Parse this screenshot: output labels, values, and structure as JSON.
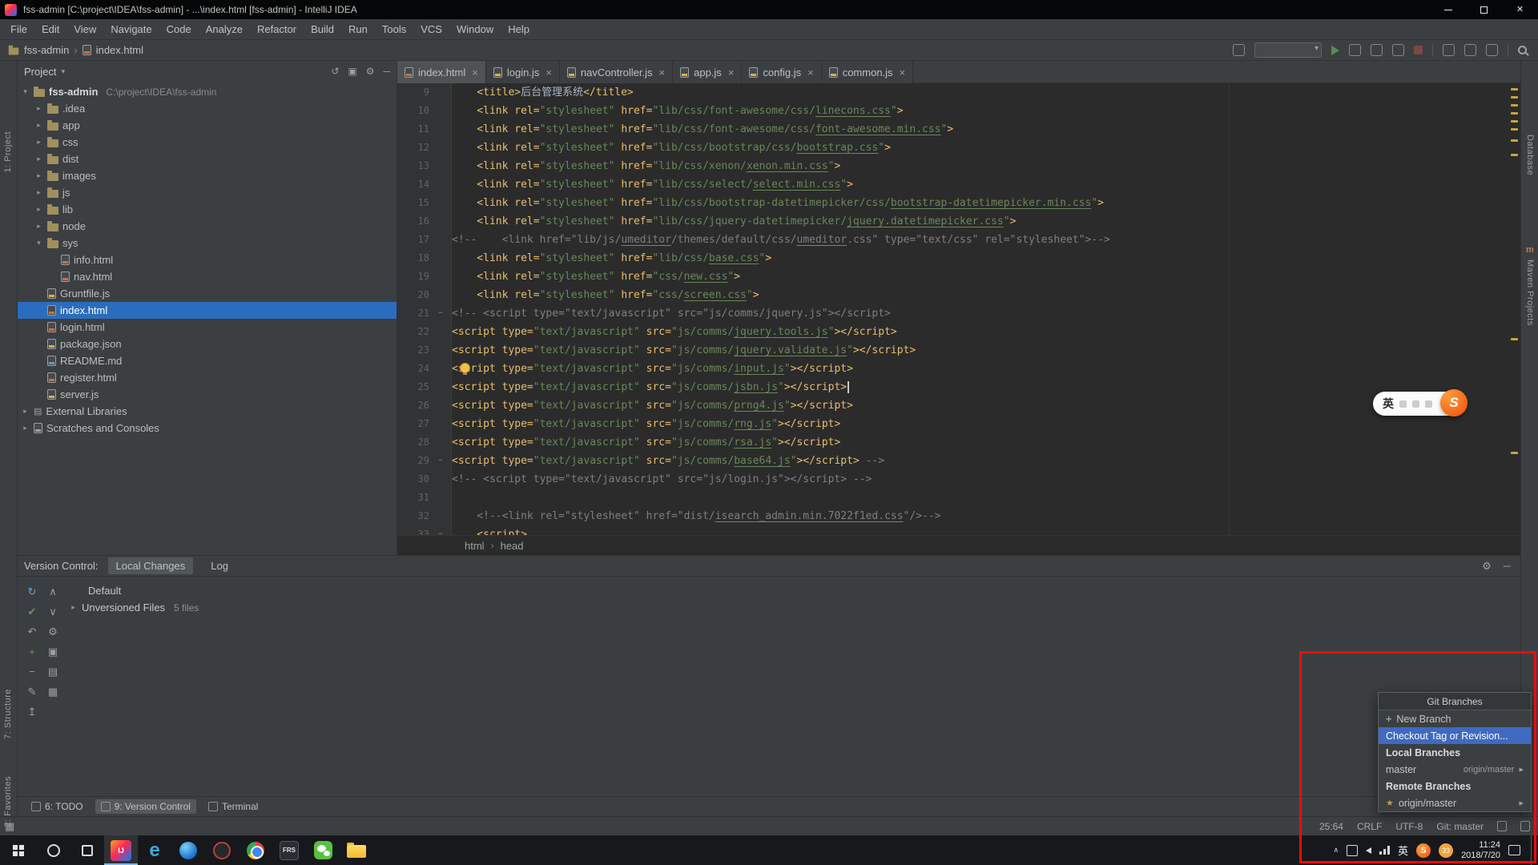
{
  "window": {
    "title": "fss-admin [C:\\project\\IDEA\\fss-admin] - ...\\index.html [fss-admin] - IntelliJ IDEA"
  },
  "menu": {
    "items": [
      "File",
      "Edit",
      "View",
      "Navigate",
      "Code",
      "Analyze",
      "Refactor",
      "Build",
      "Run",
      "Tools",
      "VCS",
      "Window",
      "Help"
    ]
  },
  "breadcrumb": {
    "project": "fss-admin",
    "file": "index.html"
  },
  "left_strip": {
    "project": "1: Project",
    "structure": "7: Structure",
    "favorites": "2: Favorites"
  },
  "right_strip": {
    "top": "Database",
    "bottom": "Maven Projects",
    "maven_icon": "m"
  },
  "project_panel": {
    "header": "Project",
    "items": [
      {
        "l": "fss-admin",
        "icon": "folder",
        "d": 0,
        "a": "v",
        "root": true,
        "path": "C:\\project\\IDEA\\fss-admin"
      },
      {
        "l": ".idea",
        "icon": "folder",
        "d": 1,
        "a": "r"
      },
      {
        "l": "app",
        "icon": "folder",
        "d": 1,
        "a": "r"
      },
      {
        "l": "css",
        "icon": "folder",
        "d": 1,
        "a": "r"
      },
      {
        "l": "dist",
        "icon": "folder",
        "d": 1,
        "a": "r"
      },
      {
        "l": "images",
        "icon": "folder",
        "d": 1,
        "a": "r"
      },
      {
        "l": "js",
        "icon": "folder",
        "d": 1,
        "a": "r"
      },
      {
        "l": "lib",
        "icon": "folder",
        "d": 1,
        "a": "r"
      },
      {
        "l": "node",
        "icon": "folder",
        "d": 1,
        "a": "r"
      },
      {
        "l": "sys",
        "icon": "folder",
        "d": 1,
        "a": "v"
      },
      {
        "l": "info.html",
        "icon": "html",
        "d": 2
      },
      {
        "l": "nav.html",
        "icon": "html",
        "d": 2
      },
      {
        "l": "Gruntfile.js",
        "icon": "js",
        "d": 1
      },
      {
        "l": "index.html",
        "icon": "html",
        "d": 1,
        "sel": true
      },
      {
        "l": "login.html",
        "icon": "html",
        "d": 1
      },
      {
        "l": "package.json",
        "icon": "json",
        "d": 1
      },
      {
        "l": "README.md",
        "icon": "md",
        "d": 1
      },
      {
        "l": "register.html",
        "icon": "html",
        "d": 1
      },
      {
        "l": "server.js",
        "icon": "js",
        "d": 1
      },
      {
        "l": "External Libraries",
        "icon": "lib",
        "d": 0,
        "a": "r"
      },
      {
        "l": "Scratches and Consoles",
        "icon": "scratch",
        "d": 0,
        "a": "r"
      }
    ]
  },
  "editor": {
    "tabs": [
      {
        "label": "index.html",
        "type": "html",
        "active": true
      },
      {
        "label": "login.js",
        "type": "js"
      },
      {
        "label": "navController.js",
        "type": "js"
      },
      {
        "label": "app.js",
        "type": "js"
      },
      {
        "label": "config.js",
        "type": "js"
      },
      {
        "label": "common.js",
        "type": "js"
      }
    ],
    "caret": {
      "line": 25,
      "col": 64
    },
    "stripe_marks": [
      6,
      16,
      26,
      36,
      46,
      56,
      70,
      88,
      318,
      460
    ],
    "breadcrumbs": [
      "html",
      "head"
    ],
    "lines": [
      {
        "n": 9,
        "tk": [
          [
            "t",
            "    <title>"
          ],
          [
            "p",
            "后台管理系统"
          ],
          [
            "t",
            "</title>"
          ]
        ]
      },
      {
        "n": 10,
        "tk": [
          [
            "t",
            "    <link rel="
          ],
          [
            "s",
            "\"stylesheet\""
          ],
          [
            "t",
            " href="
          ],
          [
            "s",
            "\"lib/css/font-awesome/css/"
          ],
          [
            "u",
            "linecons.css"
          ],
          [
            "s",
            "\""
          ],
          [
            "t",
            ">"
          ]
        ]
      },
      {
        "n": 11,
        "tk": [
          [
            "t",
            "    <link rel="
          ],
          [
            "s",
            "\"stylesheet\""
          ],
          [
            "t",
            " href="
          ],
          [
            "s",
            "\"lib/css/font-awesome/css/"
          ],
          [
            "u",
            "font-awesome.min.css"
          ],
          [
            "s",
            "\""
          ],
          [
            "t",
            ">"
          ]
        ]
      },
      {
        "n": 12,
        "tk": [
          [
            "t",
            "    <link rel="
          ],
          [
            "s",
            "\"stylesheet\""
          ],
          [
            "t",
            " href="
          ],
          [
            "s",
            "\"lib/css/bootstrap/css/"
          ],
          [
            "u",
            "bootstrap.css"
          ],
          [
            "s",
            "\""
          ],
          [
            "t",
            ">"
          ]
        ]
      },
      {
        "n": 13,
        "tk": [
          [
            "t",
            "    <link rel="
          ],
          [
            "s",
            "\"stylesheet\""
          ],
          [
            "t",
            " href="
          ],
          [
            "s",
            "\"lib/css/xenon/"
          ],
          [
            "u",
            "xenon.min.css"
          ],
          [
            "s",
            "\""
          ],
          [
            "t",
            ">"
          ]
        ]
      },
      {
        "n": 14,
        "tk": [
          [
            "t",
            "    <link rel="
          ],
          [
            "s",
            "\"stylesheet\""
          ],
          [
            "t",
            " href="
          ],
          [
            "s",
            "\"lib/css/select/"
          ],
          [
            "u",
            "select.min.css"
          ],
          [
            "s",
            "\""
          ],
          [
            "t",
            ">"
          ]
        ]
      },
      {
        "n": 15,
        "tk": [
          [
            "t",
            "    <link rel="
          ],
          [
            "s",
            "\"stylesheet\""
          ],
          [
            "t",
            " href="
          ],
          [
            "s",
            "\"lib/css/bootstrap-datetimepicker/css/"
          ],
          [
            "u",
            "bootstrap-datetimepicker.min.css"
          ],
          [
            "s",
            "\""
          ],
          [
            "t",
            ">"
          ]
        ]
      },
      {
        "n": 16,
        "tk": [
          [
            "t",
            "    <link rel="
          ],
          [
            "s",
            "\"stylesheet\""
          ],
          [
            "t",
            " href="
          ],
          [
            "s",
            "\"lib/css/jquery-datetimepicker/"
          ],
          [
            "u",
            "jquery.datetimepicker.css"
          ],
          [
            "s",
            "\""
          ],
          [
            "t",
            ">"
          ]
        ]
      },
      {
        "n": 17,
        "tk": [
          [
            "c",
            "<!--    <link href=\"lib/js/"
          ],
          [
            "cu",
            "umeditor"
          ],
          [
            "c",
            "/themes/default/css/"
          ],
          [
            "cu",
            "umeditor"
          ],
          [
            "c",
            ".css\" type=\"text/css\" rel=\"stylesheet\">-->"
          ]
        ]
      },
      {
        "n": 18,
        "tk": [
          [
            "t",
            "    <link rel="
          ],
          [
            "s",
            "\"stylesheet\""
          ],
          [
            "t",
            " href="
          ],
          [
            "s",
            "\"lib/css/"
          ],
          [
            "u",
            "base.css"
          ],
          [
            "s",
            "\""
          ],
          [
            "t",
            ">"
          ]
        ]
      },
      {
        "n": 19,
        "tk": [
          [
            "t",
            "    <link rel="
          ],
          [
            "s",
            "\"stylesheet\""
          ],
          [
            "t",
            " href="
          ],
          [
            "s",
            "\"css/"
          ],
          [
            "u",
            "new.css"
          ],
          [
            "s",
            "\""
          ],
          [
            "t",
            ">"
          ]
        ]
      },
      {
        "n": 20,
        "tk": [
          [
            "t",
            "    <link rel="
          ],
          [
            "s",
            "\"stylesheet\""
          ],
          [
            "t",
            " href="
          ],
          [
            "s",
            "\"css/"
          ],
          [
            "u",
            "screen.css"
          ],
          [
            "s",
            "\""
          ],
          [
            "t",
            ">"
          ]
        ]
      },
      {
        "n": 21,
        "fold": "start",
        "tk": [
          [
            "c",
            "<!-- <script type=\"text/javascript\" src=\"js/comms/jquery.js\"></script>"
          ]
        ]
      },
      {
        "n": 22,
        "tk": [
          [
            "t",
            "<script type="
          ],
          [
            "s",
            "\"text/javascript\""
          ],
          [
            "t",
            " src="
          ],
          [
            "s",
            "\"js/comms/"
          ],
          [
            "u",
            "jquery.tools.js"
          ],
          [
            "s",
            "\""
          ],
          [
            "t",
            "></script>"
          ]
        ]
      },
      {
        "n": 23,
        "tk": [
          [
            "t",
            "<script type="
          ],
          [
            "s",
            "\"text/javascript\""
          ],
          [
            "t",
            " src="
          ],
          [
            "s",
            "\"js/comms/"
          ],
          [
            "u",
            "jquery.validate.js"
          ],
          [
            "s",
            "\""
          ],
          [
            "t",
            "></script>"
          ]
        ]
      },
      {
        "n": 24,
        "tk": [
          [
            "t",
            "<script type="
          ],
          [
            "s",
            "\"text/javascript\""
          ],
          [
            "t",
            " src="
          ],
          [
            "s",
            "\"js/comms/"
          ],
          [
            "u",
            "input.js"
          ],
          [
            "s",
            "\""
          ],
          [
            "t",
            "></script>"
          ]
        ]
      },
      {
        "n": 25,
        "tk": [
          [
            "t",
            "<script type="
          ],
          [
            "s",
            "\"text/javascript\""
          ],
          [
            "t",
            " src="
          ],
          [
            "s",
            "\"js/comms/"
          ],
          [
            "u",
            "jsbn.js"
          ],
          [
            "s",
            "\""
          ],
          [
            "t",
            "></script>"
          ]
        ]
      },
      {
        "n": 26,
        "tk": [
          [
            "t",
            "<script type="
          ],
          [
            "s",
            "\"text/javascript\""
          ],
          [
            "t",
            " src="
          ],
          [
            "s",
            "\"js/comms/"
          ],
          [
            "u",
            "prng4.js"
          ],
          [
            "s",
            "\""
          ],
          [
            "t",
            "></script>"
          ]
        ]
      },
      {
        "n": 27,
        "tk": [
          [
            "t",
            "<script type="
          ],
          [
            "s",
            "\"text/javascript\""
          ],
          [
            "t",
            " src="
          ],
          [
            "s",
            "\"js/comms/"
          ],
          [
            "u",
            "rng.js"
          ],
          [
            "s",
            "\""
          ],
          [
            "t",
            "></script>"
          ]
        ]
      },
      {
        "n": 28,
        "tk": [
          [
            "t",
            "<script type="
          ],
          [
            "s",
            "\"text/javascript\""
          ],
          [
            "t",
            " src="
          ],
          [
            "s",
            "\"js/comms/"
          ],
          [
            "u",
            "rsa.js"
          ],
          [
            "s",
            "\""
          ],
          [
            "t",
            "></script>"
          ]
        ]
      },
      {
        "n": 29,
        "fold": "end",
        "tk": [
          [
            "t",
            "<script type="
          ],
          [
            "s",
            "\"text/javascript\""
          ],
          [
            "t",
            " src="
          ],
          [
            "s",
            "\"js/comms/"
          ],
          [
            "u",
            "base64.js"
          ],
          [
            "s",
            "\""
          ],
          [
            "t",
            "></script>"
          ],
          [
            "c",
            " -->"
          ]
        ]
      },
      {
        "n": 30,
        "tk": [
          [
            "c",
            "<!-- <script type=\"text/javascript\" src=\"js/login.js\"></script> -->"
          ]
        ]
      },
      {
        "n": 31,
        "tk": []
      },
      {
        "n": 32,
        "tk": [
          [
            "c",
            "    <!--<link rel=\"stylesheet\" href=\"dist/"
          ],
          [
            "cu",
            "isearch_admin.min.7022f1ed.css"
          ],
          [
            "c",
            "\"/>-->"
          ]
        ]
      },
      {
        "n": 33,
        "fold": "start",
        "tk": [
          [
            "t",
            "    <script>"
          ]
        ]
      }
    ]
  },
  "version_control": {
    "label": "Version Control:",
    "tabs": [
      {
        "label": "Local Changes",
        "active": true
      },
      {
        "label": "Log"
      }
    ],
    "changelist": "Default",
    "unversioned_label": "Unversioned Files",
    "unversioned_count": "5 files",
    "toolbar_icons": [
      {
        "g": "↻",
        "c": "#6a9fd8",
        "name": "refresh-icon"
      },
      {
        "g": "∧",
        "name": "expand-all-icon"
      },
      {
        "g": "✔",
        "c": "#5f9b58",
        "name": "commit-icon"
      },
      {
        "g": "∨",
        "name": "collapse-all-icon"
      },
      {
        "g": "↶",
        "name": "revert-icon"
      },
      {
        "g": "⚙",
        "name": "settings-icon"
      },
      {
        "g": "+",
        "c": "#5f9b58",
        "name": "add-icon"
      },
      {
        "g": "▣",
        "name": "group-by-icon"
      },
      {
        "g": "−",
        "name": "remove-icon"
      },
      {
        "g": "▤",
        "name": "details-icon"
      },
      {
        "g": "✎",
        "name": "edit-icon"
      },
      {
        "g": "▦",
        "name": "preview-diff-icon"
      },
      {
        "g": "↥",
        "name": "shelve-icon"
      }
    ]
  },
  "toolwindow_bar": {
    "items": [
      {
        "label": "6: TODO"
      },
      {
        "label": "9: Version Control",
        "active": true
      },
      {
        "label": "Terminal"
      }
    ]
  },
  "status_bar": {
    "position": "25:64",
    "line_sep": "CRLF",
    "encoding": "UTF-8",
    "git": "Git: master"
  },
  "git_popup": {
    "title": "Git Branches",
    "items": [
      {
        "label": "New Branch",
        "plus": true
      },
      {
        "label": "Checkout Tag or Revision...",
        "selected": true
      },
      {
        "label": "Local Branches",
        "header": true
      },
      {
        "label": "master",
        "right": "origin/master",
        "arrow": true
      },
      {
        "label": "Remote Branches",
        "header": true
      },
      {
        "label": "origin/master",
        "star": true,
        "arrow": true
      }
    ]
  },
  "taskbar": {
    "apps": [
      {
        "name": "start"
      },
      {
        "name": "cortana-search"
      },
      {
        "name": "task-view"
      },
      {
        "name": "intellij",
        "active": true
      },
      {
        "name": "edge"
      },
      {
        "name": "browser-globe"
      },
      {
        "name": "dark-app"
      },
      {
        "name": "chrome"
      },
      {
        "name": "frs",
        "label": "FRS"
      },
      {
        "name": "wechat"
      },
      {
        "name": "file-explorer"
      }
    ],
    "ime": "英",
    "sogou": "S",
    "badge": "33",
    "clock_time": "11:24",
    "clock_date": "2018/7/20"
  },
  "ime": {
    "mode": "英",
    "logo": "S"
  }
}
